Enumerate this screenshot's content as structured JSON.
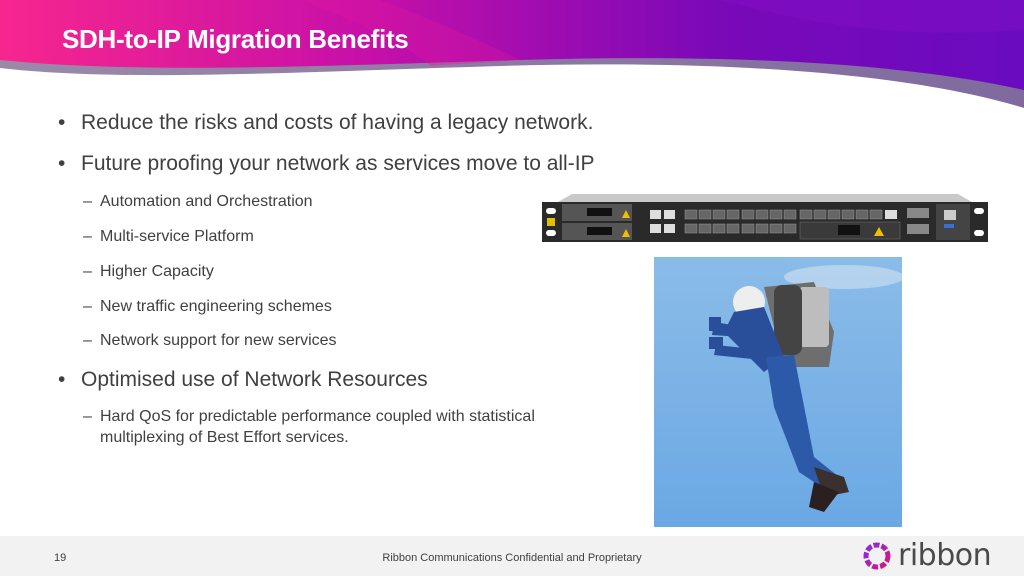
{
  "slide": {
    "title": "SDH-to-IP Migration Benefits",
    "bullets": [
      {
        "text": "Reduce the risks and costs of having a legacy network.",
        "children": []
      },
      {
        "text": "Future proofing your network as services move to all-IP",
        "children": [
          "Automation and Orchestration",
          "Multi-service Platform",
          "Higher Capacity",
          "New traffic engineering schemes",
          "Network support for new services"
        ]
      },
      {
        "text": "Optimised use of Network Resources",
        "children": [
          "Hard QoS for predictable performance coupled with statistical",
          "multiplexing of Best Effort services."
        ]
      }
    ],
    "bullet_glyph": "•",
    "dash_glyph": "–",
    "images": {
      "router": "network-router-photo",
      "jetpack": "jetpack-flyer-photo"
    }
  },
  "footer": {
    "page_number": "19",
    "confidentiality": "Ribbon Communications Confidential and Proprietary",
    "logo_text": "ribbon"
  },
  "colors": {
    "brand_pink": "#f0288c",
    "brand_purple": "#6a0dbd",
    "text_gray": "#404040",
    "footer_bg": "#f2f2f2"
  }
}
